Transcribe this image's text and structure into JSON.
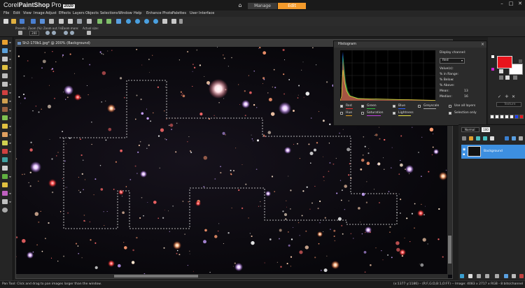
{
  "app": {
    "brand_prefix": "Corel",
    "brand_name": "PaintShop",
    "brand_suffix": " Pro",
    "version": "2020",
    "home_icon": "home-icon"
  },
  "workspace_tabs": [
    {
      "label": "Manage",
      "active": false
    },
    {
      "label": "Edit",
      "active": true
    }
  ],
  "window_controls": [
    "minimize-icon",
    "maximize-icon",
    "close-icon"
  ],
  "menu": [
    "File",
    "Edit",
    "View",
    "Image",
    "Adjust",
    "Effects",
    "Layers",
    "Objects",
    "Selections",
    "Window",
    "Help",
    "Enhance Photo",
    "Palettes",
    "User Interface"
  ],
  "options": {
    "presets_label": "Presets:",
    "zoom_label": "Zoom (%):",
    "zoom_value": "200",
    "zoom_out_label": "Zoom out / In:",
    "zoom_more_label": "Zoom more:",
    "actual_size_label": "Actual size:"
  },
  "document": {
    "title": "Sh2-170b1.jpg* @ 200% (Background)"
  },
  "histogram": {
    "title": "Histogram",
    "display_channel_label": "Display channel:",
    "display_channel_value": "Red",
    "values_label": "Value(s):",
    "in_range_label": "% in Range:",
    "below_label": "% Below:",
    "above_label": "% Above:",
    "mean_label": "Mean:",
    "mean_value": "13",
    "median_label": "Median:",
    "median_value": "16",
    "channels": [
      {
        "label": "Red",
        "checked": true,
        "color": "#e83030"
      },
      {
        "label": "Green",
        "checked": true,
        "color": "#30c040"
      },
      {
        "label": "Blue",
        "checked": true,
        "color": "#3060ff"
      },
      {
        "label": "Greyscale",
        "checked": false,
        "color": "#aaaaaa"
      },
      {
        "label": "Hue",
        "checked": false,
        "color": "#e0a020"
      },
      {
        "label": "Saturation",
        "checked": false,
        "color": "#c040e0"
      },
      {
        "label": "Lightness",
        "checked": true,
        "color": "#e8e040"
      }
    ],
    "use_all_layers_label": "Use all layers",
    "use_all_layers_checked": false,
    "selection_only_label": "Selection only",
    "selection_only_checked": true
  },
  "materials": {
    "foreground_color": "#e8141c",
    "background_color": "#ffffff",
    "texture_label": "Texture",
    "recent_colors": [
      "#ffffff",
      "#ffffff",
      "#ffffff",
      "#ffffff",
      "#ffffff",
      "#1a3cff",
      "#e8141c"
    ]
  },
  "layers": {
    "blend_mode": "Normal",
    "opacity": "100",
    "layer_name": "Background"
  },
  "status": {
    "left": "Pan Tool: Click and drag to pan images larger than the window.",
    "right": "(x:1377 y:1186) – (R:F,G:D,B:1,O:FF) -- Image: 4083 x 2717 x RGB - 8 bits/channel"
  }
}
